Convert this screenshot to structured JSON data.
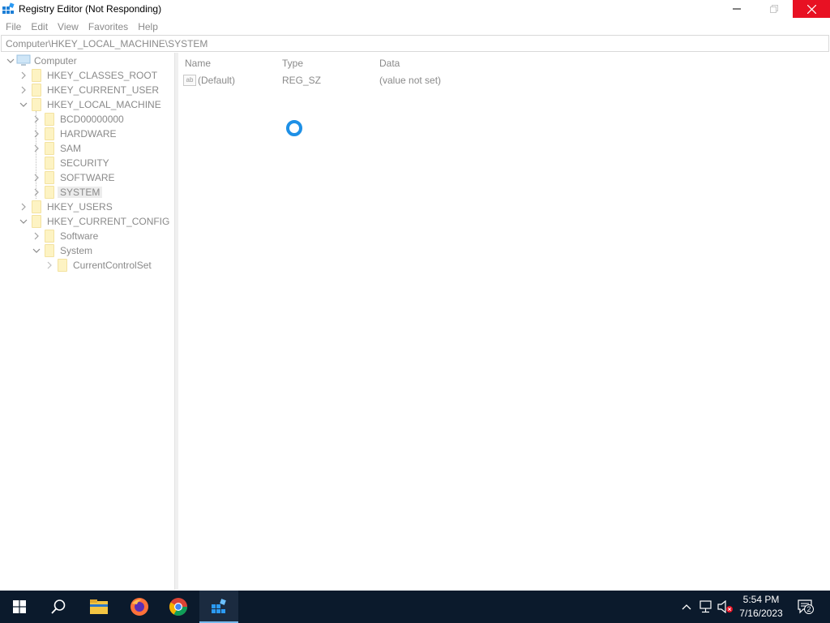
{
  "window": {
    "title": "Registry Editor (Not Responding)",
    "controls": {
      "minimize": "minimize",
      "maximize": "maximize",
      "close": "close"
    }
  },
  "menu": [
    "File",
    "Edit",
    "View",
    "Favorites",
    "Help"
  ],
  "address": "Computer\\HKEY_LOCAL_MACHINE\\SYSTEM",
  "tree": {
    "root": "Computer",
    "hkcr": "HKEY_CLASSES_ROOT",
    "hkcu": "HKEY_CURRENT_USER",
    "hklm": "HKEY_LOCAL_MACHINE",
    "bcd": "BCD00000000",
    "hardware": "HARDWARE",
    "sam": "SAM",
    "security": "SECURITY",
    "software": "SOFTWARE",
    "system": "SYSTEM",
    "hku": "HKEY_USERS",
    "hkcc": "HKEY_CURRENT_CONFIG",
    "cc_software": "Software",
    "cc_system": "System",
    "ccs": "CurrentControlSet"
  },
  "list": {
    "columns": {
      "name": "Name",
      "type": "Type",
      "data": "Data"
    },
    "rows": [
      {
        "icon": "ab",
        "name": "(Default)",
        "type": "REG_SZ",
        "data": "(value not set)"
      }
    ]
  },
  "taskbar": {
    "apps": [
      "start-icon",
      "search-icon",
      "file-explorer-icon",
      "firefox-icon",
      "chrome-icon",
      "regedit-icon"
    ],
    "time": "5:54 PM",
    "date": "7/16/2023",
    "notification_count": "2"
  },
  "colors": {
    "close_button": "#e81123",
    "taskbar": "#0b1a2c",
    "spinner": "#1e90e6",
    "folder": "#fdf3c3"
  }
}
